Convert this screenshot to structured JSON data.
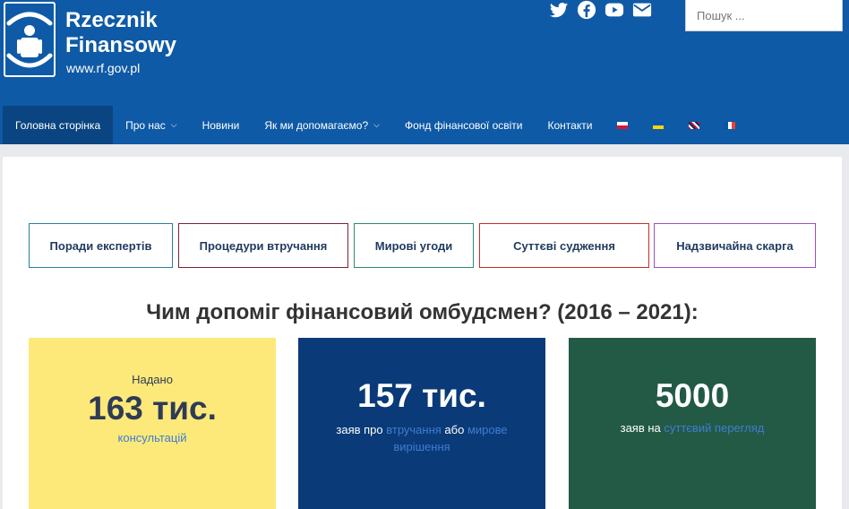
{
  "header": {
    "logo_line1": "Rzecznik",
    "logo_line2": "Finansowy",
    "url": "www.rf.gov.pl",
    "social_icons": [
      "twitter-icon",
      "facebook-icon",
      "youtube-icon",
      "mail-icon"
    ],
    "search_placeholder": "Пошук ..."
  },
  "nav": {
    "items": [
      {
        "label": "Головна сторінка",
        "active": true
      },
      {
        "label": "Про нас",
        "dropdown": true
      },
      {
        "label": "Новини"
      },
      {
        "label": "Як ми допомагаємо?",
        "dropdown": true
      },
      {
        "label": "Фонд фінансової освіти"
      },
      {
        "label": "Контакти"
      }
    ],
    "flags": [
      "flag-pl",
      "flag-ua",
      "flag-gb",
      "flag-fr"
    ]
  },
  "main": {
    "buttons": [
      {
        "label": "Поради експертів",
        "color": "#2a7fa0"
      },
      {
        "label": "Процедури втручання",
        "color": "#7a2535"
      },
      {
        "label": "Мирові угоди",
        "color": "#2a8a70"
      },
      {
        "label": "Суттєві судження",
        "color": "#cc2b2b"
      },
      {
        "label": "Надзвичайна скарга",
        "color": "#9b4fc9"
      }
    ],
    "headline": "Чим допоміг фінансовий омбудсмен? (2016 – 2021):",
    "cards": [
      {
        "pre": "Надано",
        "big": "163 тис.",
        "link": "консультацій",
        "bg": "#fce97a",
        "fg": "#2f3b55"
      },
      {
        "big": "157 тис.",
        "t1": "заяв про ",
        "l1": "втручання",
        "t2": " або ",
        "l2": "мирове вирішення",
        "bg": "#0a3a78",
        "fg": "#ffffff"
      },
      {
        "big": "5000",
        "t1": "заяв на ",
        "l1": "суттєвий перегляд",
        "bg": "#235a46",
        "fg": "#ffffff"
      }
    ]
  }
}
